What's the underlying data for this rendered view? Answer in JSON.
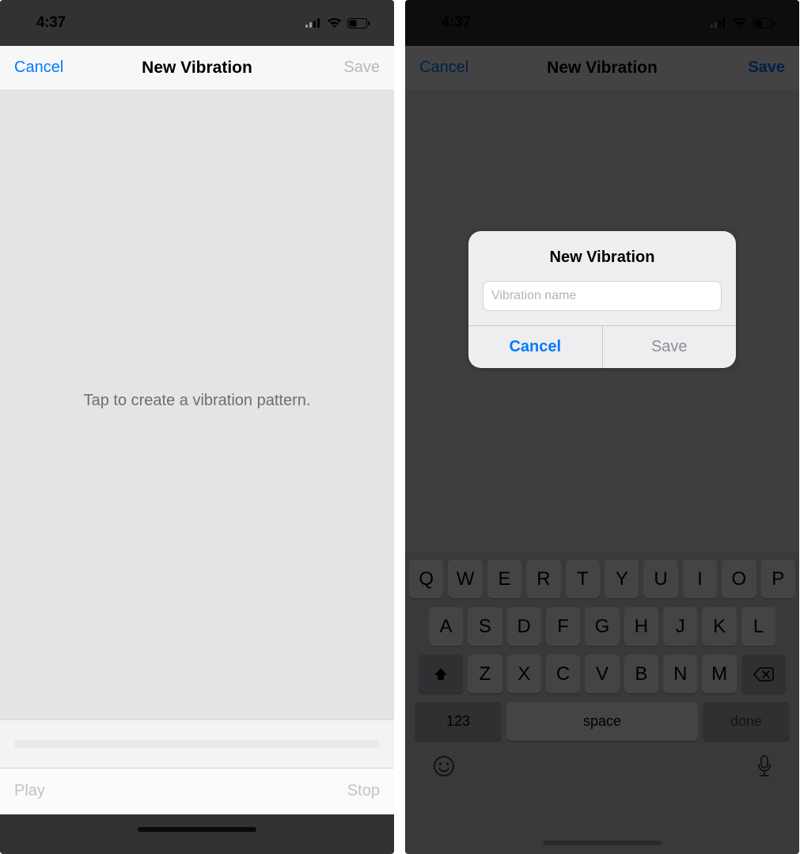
{
  "status": {
    "time": "4:37"
  },
  "colors": {
    "accent": "#007aff",
    "dimmed": "#b9b9be"
  },
  "left": {
    "nav": {
      "cancel": "Cancel",
      "title": "New Vibration",
      "save": "Save",
      "save_enabled": false
    },
    "body": {
      "message": "Tap to create a vibration pattern."
    },
    "controls": {
      "play": "Play",
      "stop": "Stop"
    }
  },
  "right": {
    "nav": {
      "cancel": "Cancel",
      "title": "New Vibration",
      "save": "Save",
      "save_enabled": true
    },
    "alert": {
      "title": "New Vibration",
      "placeholder": "Vibration name",
      "value": "",
      "cancel": "Cancel",
      "save": "Save"
    },
    "keyboard": {
      "row1": [
        "Q",
        "W",
        "E",
        "R",
        "T",
        "Y",
        "U",
        "I",
        "O",
        "P"
      ],
      "row2": [
        "A",
        "S",
        "D",
        "F",
        "G",
        "H",
        "J",
        "K",
        "L"
      ],
      "row3": [
        "Z",
        "X",
        "C",
        "V",
        "B",
        "N",
        "M"
      ],
      "num": "123",
      "space": "space",
      "done": "done"
    }
  }
}
